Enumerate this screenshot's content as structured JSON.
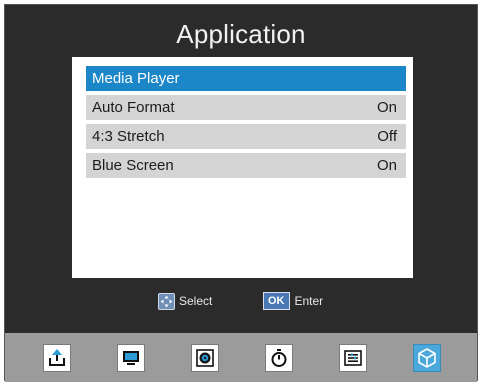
{
  "header": {
    "title": "Application"
  },
  "menu": {
    "items": [
      {
        "label": "Media Player",
        "value": "",
        "selected": true
      },
      {
        "label": "Auto Format",
        "value": "On",
        "selected": false
      },
      {
        "label": "4:3 Stretch",
        "value": "Off",
        "selected": false
      },
      {
        "label": "Blue Screen",
        "value": "On",
        "selected": false
      }
    ]
  },
  "hints": {
    "select_label": "Select",
    "ok_key": "OK",
    "enter_label": "Enter"
  },
  "dock": {
    "items": [
      {
        "icon": "upload-icon"
      },
      {
        "icon": "monitor-icon"
      },
      {
        "icon": "speaker-icon"
      },
      {
        "icon": "timer-icon"
      },
      {
        "icon": "settings-list-icon"
      },
      {
        "icon": "cube-icon",
        "active": true
      }
    ]
  },
  "colors": {
    "background": "#2b2b2b",
    "selected_row": "#1b86c8",
    "row": "#d4d4d4",
    "dock": "#9b9b9b",
    "dock_active": "#4aa8db"
  }
}
